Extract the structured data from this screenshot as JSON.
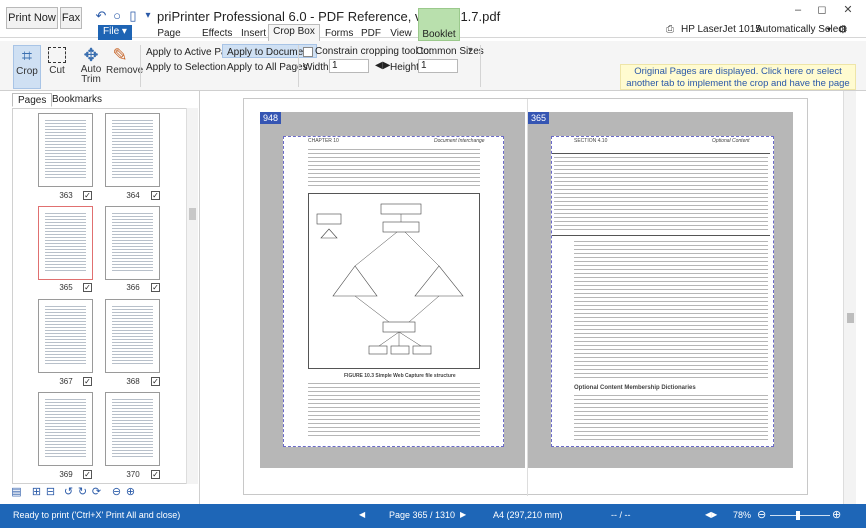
{
  "titlebar": {
    "print_now": "Print Now",
    "fax": "Fax",
    "title": "priPrinter Professional 6.0 - PDF Reference, version 1.7.pdf",
    "printer_name": "HP LaserJet 1015",
    "printer_mode": "Automatically Select"
  },
  "tabs": {
    "file": "File",
    "page_layout": "Page Layout",
    "effects": "Effects",
    "insert": "Insert",
    "crop_box": "Crop Box",
    "forms": "Forms",
    "pdf": "PDF",
    "view": "View",
    "booklet": "Booklet"
  },
  "ribbon": {
    "crop": "Crop",
    "cut": "Cut",
    "auto_trim": "Auto Trim",
    "remove": "Remove",
    "apply_active": "Apply to Active Page",
    "apply_document": "Apply to Document",
    "apply_selection": "Apply to Selection",
    "apply_all": "Apply to All Pages",
    "constrain_label": "Constrain cropping tool to:",
    "common_sizes": "Common Sizes",
    "width_label": "Width:",
    "width_value": "1",
    "height_label": "Height:",
    "height_value": "1",
    "info_banner": "Original Pages are displayed. Click here or select another tab to implement the crop and have the page display your changes."
  },
  "panel": {
    "pages_tab": "Pages",
    "bookmarks_tab": "Bookmarks",
    "thumbs": [
      {
        "num": "363",
        "checked": "✓"
      },
      {
        "num": "364",
        "checked": "✓"
      },
      {
        "num": "365",
        "checked": "✓"
      },
      {
        "num": "366",
        "checked": "✓"
      },
      {
        "num": "367",
        "checked": "✓"
      },
      {
        "num": "368",
        "checked": "✓"
      },
      {
        "num": "369",
        "checked": "✓"
      },
      {
        "num": "370",
        "checked": "✓"
      }
    ]
  },
  "docview": {
    "left_page_label": "948",
    "right_page_label": "365",
    "left_header_left": "CHAPTER 10",
    "left_header_right": "Document Interchange",
    "right_header_left": "SECTION 4.10",
    "right_header_right": "Optional Content",
    "figure_caption": "FIGURE 10.3 Simple Web Capture file structure",
    "right_subhead": "Optional Content Membership Dictionaries"
  },
  "status": {
    "ready": "Ready to print ('Ctrl+X' Print All and close)",
    "page": "Page 365 / 1310",
    "size": "A4 (297,210 mm)",
    "range": "-- / --",
    "zoom": "78%"
  },
  "colors": {
    "accent": "#1e66b7",
    "booklet_tab": "#b9e0ad",
    "banner_bg": "#fffbd0",
    "page_label": "#3555b3"
  }
}
